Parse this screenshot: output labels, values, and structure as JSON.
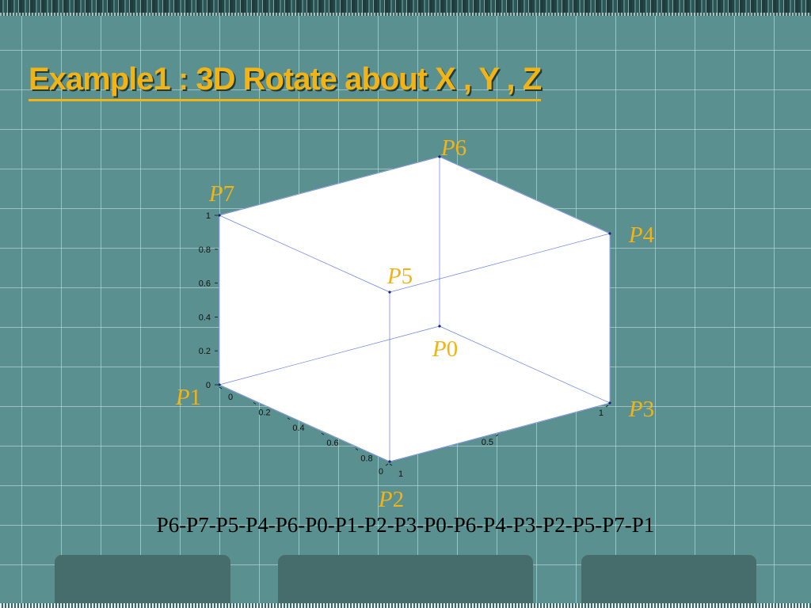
{
  "slide": {
    "title": "Example1 : 3D Rotate about X , Y , Z",
    "sequence": "P6-P7-P5-P4-P6-P0-P1-P2-P3-P0-P6-P4-P3-P2-P5-P7-P1"
  },
  "colors": {
    "background": "#5b9090",
    "title": "#f2b414",
    "point_label": "#f2b414",
    "edge": "#3355dd",
    "panel": "#476c6c"
  },
  "chart_data": {
    "type": "3d-wireframe",
    "points": [
      {
        "name": "P0",
        "x": 0,
        "y": 0,
        "z": 0
      },
      {
        "name": "P1",
        "x": 1,
        "y": 0,
        "z": 0
      },
      {
        "name": "P2",
        "x": 1,
        "y": 1,
        "z": 0
      },
      {
        "name": "P3",
        "x": 0,
        "y": 1,
        "z": 0
      },
      {
        "name": "P4",
        "x": 0,
        "y": 1,
        "z": 1
      },
      {
        "name": "P5",
        "x": 1,
        "y": 1,
        "z": 1
      },
      {
        "name": "P6",
        "x": 0,
        "y": 0,
        "z": 1
      },
      {
        "name": "P7",
        "x": 1,
        "y": 0,
        "z": 1
      }
    ],
    "edges": [
      [
        "P6",
        "P7"
      ],
      [
        "P7",
        "P5"
      ],
      [
        "P5",
        "P4"
      ],
      [
        "P4",
        "P6"
      ],
      [
        "P6",
        "P0"
      ],
      [
        "P0",
        "P1"
      ],
      [
        "P1",
        "P2"
      ],
      [
        "P2",
        "P3"
      ],
      [
        "P3",
        "P0"
      ],
      [
        "P4",
        "P3"
      ],
      [
        "P2",
        "P5"
      ],
      [
        "P7",
        "P1"
      ]
    ],
    "axes": {
      "x": {
        "ticks": [
          0,
          0.5,
          1
        ],
        "labels": [
          "0",
          "0.5",
          "1"
        ],
        "range": [
          0,
          1
        ]
      },
      "y": {
        "ticks": [
          0,
          0.2,
          0.4,
          0.6,
          0.8,
          1
        ],
        "labels": [
          "0",
          "0.2",
          "0.4",
          "0.6",
          "0.8",
          "1"
        ],
        "range": [
          0,
          1
        ]
      },
      "z": {
        "ticks": [
          0,
          0.2,
          0.4,
          0.6,
          0.8,
          1
        ],
        "labels": [
          "0",
          "0.2",
          "0.4",
          "0.6",
          "0.8",
          "1"
        ],
        "range": [
          0,
          1
        ]
      }
    },
    "point_labels": [
      {
        "letter": "P",
        "index": "6",
        "point": "P6"
      },
      {
        "letter": "P",
        "index": "7",
        "point": "P7"
      },
      {
        "letter": "P",
        "index": "4",
        "point": "P4"
      },
      {
        "letter": "P",
        "index": "5",
        "point": "P5"
      },
      {
        "letter": "P",
        "index": "0",
        "point": "P0"
      },
      {
        "letter": "P",
        "index": "1",
        "point": "P1"
      },
      {
        "letter": "P",
        "index": "3",
        "point": "P3"
      },
      {
        "letter": "P",
        "index": "2",
        "point": "P2"
      }
    ]
  }
}
